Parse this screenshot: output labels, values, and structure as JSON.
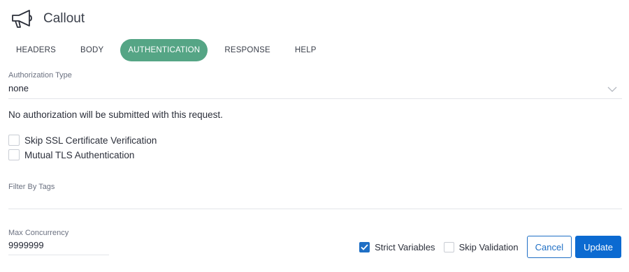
{
  "header": {
    "title": "Callout",
    "icon": "megaphone-icon"
  },
  "tabs": [
    {
      "label": "HEADERS",
      "active": false
    },
    {
      "label": "BODY",
      "active": false
    },
    {
      "label": "AUTHENTICATION",
      "active": true
    },
    {
      "label": "RESPONSE",
      "active": false
    },
    {
      "label": "HELP",
      "active": false
    }
  ],
  "auth": {
    "label": "Authorization Type",
    "value": "none",
    "info": "No authorization will be submitted with this request."
  },
  "options": {
    "skip_ssl": {
      "label": "Skip SSL Certificate Verification",
      "checked": false
    },
    "mutual_tls": {
      "label": "Mutual TLS Authentication",
      "checked": false
    }
  },
  "tags": {
    "label": "Filter By Tags",
    "value": ""
  },
  "concurrency": {
    "label": "Max Concurrency",
    "value": "9999999"
  },
  "footer": {
    "strict_variables": {
      "label": "Strict Variables",
      "checked": true
    },
    "skip_validation": {
      "label": "Skip Validation",
      "checked": false
    },
    "cancel_label": "Cancel",
    "update_label": "Update"
  },
  "colors": {
    "active_tab": "#55a585",
    "primary": "#0b6ad1"
  }
}
